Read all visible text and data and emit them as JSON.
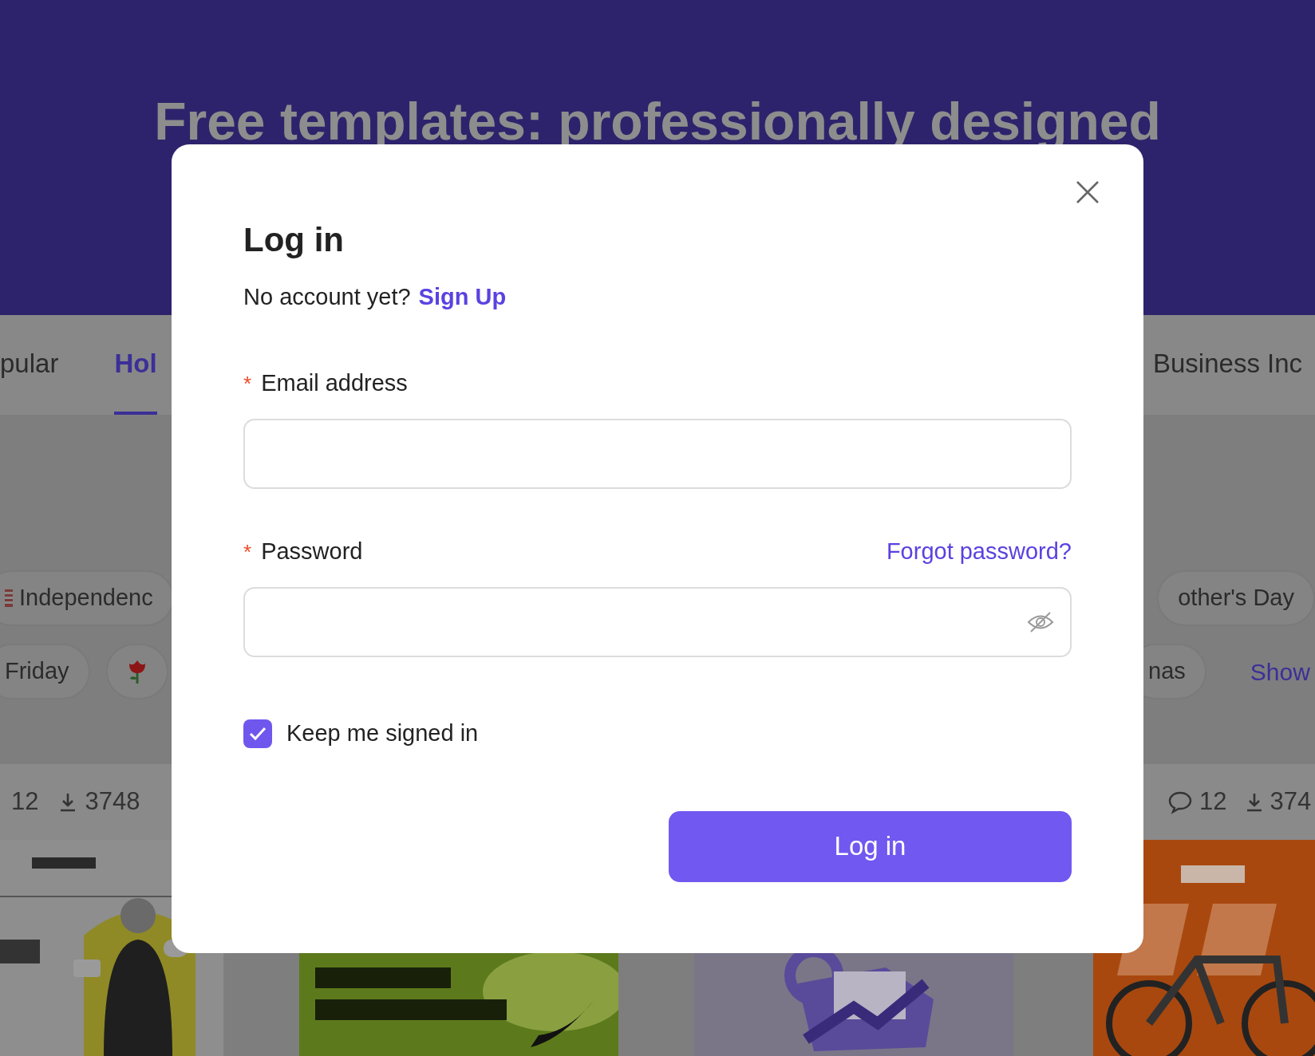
{
  "hero": {
    "title": "Free templates: professionally designed"
  },
  "tabs": [
    {
      "label": "pular",
      "selected": false
    },
    {
      "label": "Hol",
      "selected": true
    },
    {
      "label": "Business Inc",
      "selected": false
    }
  ],
  "tag_rows": [
    {
      "left": [
        {
          "kind": "flag",
          "label": "Independenc"
        }
      ],
      "right": [
        {
          "label": "other's Day"
        }
      ]
    },
    {
      "left": [
        {
          "label": "Friday"
        },
        {
          "kind": "rose"
        }
      ],
      "right": [
        {
          "label": "nas"
        }
      ],
      "link": "Show"
    }
  ],
  "stats_left": {
    "comments": "12",
    "downloads": "3748"
  },
  "stats_right": {
    "comments": "12",
    "downloads": "374"
  },
  "modal": {
    "title": "Log in",
    "prompt": "No account yet?",
    "signup_link": "Sign Up",
    "fields": [
      {
        "kind": "email",
        "marker": "*",
        "label": "Email address"
      },
      {
        "kind": "password",
        "marker": "*",
        "label": "Password",
        "aside_link": "Forgot password?"
      }
    ],
    "remember": {
      "label": "Keep me signed in",
      "checked": true
    },
    "submit": "Log in"
  }
}
